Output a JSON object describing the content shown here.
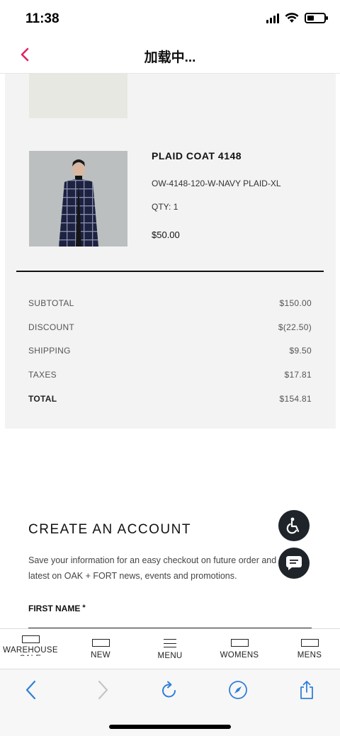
{
  "status_bar": {
    "time": "11:38"
  },
  "header": {
    "title": "加载中...",
    "accent_color": "#e0245e"
  },
  "order_item": {
    "name": "PLAID COAT 4148",
    "sku": "OW-4148-120-W-NAVY PLAID-XL",
    "qty_label": "QTY:",
    "qty_value": "1",
    "price": "$50.00"
  },
  "totals": [
    {
      "label": "SUBTOTAL",
      "value": "$150.00"
    },
    {
      "label": "DISCOUNT",
      "value": "$(22.50)"
    },
    {
      "label": "SHIPPING",
      "value": "$9.50"
    },
    {
      "label": "TAXES",
      "value": "$17.81"
    },
    {
      "label": "TOTAL",
      "value": "$154.81"
    }
  ],
  "create_account": {
    "title": "CREATE AN ACCOUNT",
    "description_line1": "Save your information for an easy checkout on future order and",
    "description_line2": "latest on OAK + FORT news, events and promotions.",
    "first_name_label": "FIRST NAME",
    "required_mark": "*"
  },
  "floating_buttons": [
    {
      "icon": "accessibility-icon"
    },
    {
      "icon": "chat-icon"
    }
  ],
  "tab_bar": {
    "items": [
      {
        "label": "WAREHOUSE SALE",
        "icon": "rectangle-icon"
      },
      {
        "label": "NEW",
        "icon": "rectangle-icon"
      },
      {
        "label": "MENU",
        "icon": "hamburger-icon"
      },
      {
        "label": "WOMENS",
        "icon": "rectangle-icon"
      },
      {
        "label": "MENS",
        "icon": "rectangle-icon"
      }
    ]
  },
  "browser_toolbar": {
    "icons": [
      "back-arrow-icon",
      "forward-arrow-icon",
      "reload-icon",
      "compass-icon",
      "share-icon"
    ],
    "tint_color": "#2f7fd8"
  }
}
